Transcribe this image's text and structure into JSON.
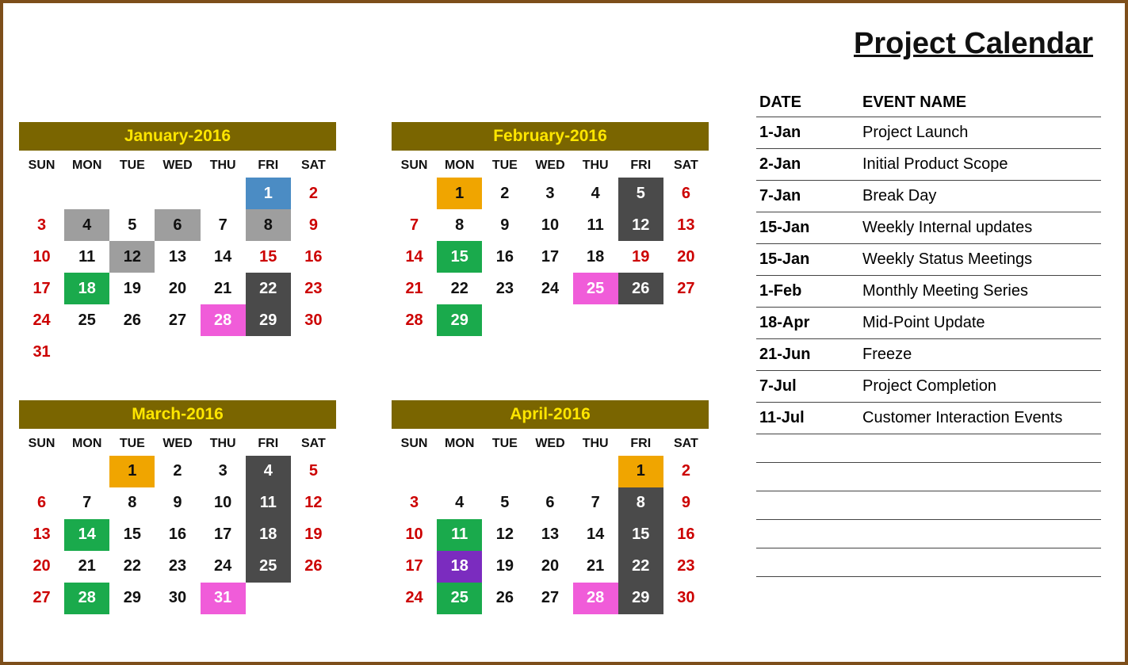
{
  "title": "Project Calendar",
  "dayHeaders": [
    "SUN",
    "MON",
    "TUE",
    "WED",
    "THU",
    "FRI",
    "SAT"
  ],
  "months": [
    {
      "title": "January-2016",
      "offset": 5,
      "days": [
        {
          "n": 1,
          "c": "bg-blue"
        },
        {
          "n": 2,
          "c": "red"
        },
        {
          "n": 3,
          "c": "red"
        },
        {
          "n": 4,
          "c": "bg-gray"
        },
        {
          "n": 5
        },
        {
          "n": 6,
          "c": "bg-gray"
        },
        {
          "n": 7
        },
        {
          "n": 8,
          "c": "bg-gray"
        },
        {
          "n": 9,
          "c": "red"
        },
        {
          "n": 10,
          "c": "red"
        },
        {
          "n": 11
        },
        {
          "n": 12,
          "c": "bg-gray"
        },
        {
          "n": 13
        },
        {
          "n": 14
        },
        {
          "n": 15,
          "c": "red"
        },
        {
          "n": 16,
          "c": "red"
        },
        {
          "n": 17,
          "c": "red"
        },
        {
          "n": 18,
          "c": "bg-green"
        },
        {
          "n": 19
        },
        {
          "n": 20
        },
        {
          "n": 21
        },
        {
          "n": 22,
          "c": "bg-dark"
        },
        {
          "n": 23,
          "c": "red"
        },
        {
          "n": 24,
          "c": "red"
        },
        {
          "n": 25
        },
        {
          "n": 26
        },
        {
          "n": 27
        },
        {
          "n": 28,
          "c": "bg-pink"
        },
        {
          "n": 29,
          "c": "bg-dark"
        },
        {
          "n": 30,
          "c": "red"
        },
        {
          "n": 31,
          "c": "red"
        }
      ]
    },
    {
      "title": "February-2016",
      "offset": 1,
      "days": [
        {
          "n": 1,
          "c": "bg-orange"
        },
        {
          "n": 2
        },
        {
          "n": 3
        },
        {
          "n": 4
        },
        {
          "n": 5,
          "c": "bg-dark"
        },
        {
          "n": 6,
          "c": "red"
        },
        {
          "n": 7,
          "c": "red"
        },
        {
          "n": 8
        },
        {
          "n": 9
        },
        {
          "n": 10
        },
        {
          "n": 11
        },
        {
          "n": 12,
          "c": "bg-dark"
        },
        {
          "n": 13,
          "c": "red"
        },
        {
          "n": 14,
          "c": "red"
        },
        {
          "n": 15,
          "c": "bg-green"
        },
        {
          "n": 16
        },
        {
          "n": 17
        },
        {
          "n": 18
        },
        {
          "n": 19,
          "c": "red"
        },
        {
          "n": 20,
          "c": "red"
        },
        {
          "n": 21,
          "c": "red"
        },
        {
          "n": 22
        },
        {
          "n": 23
        },
        {
          "n": 24
        },
        {
          "n": 25,
          "c": "bg-pink"
        },
        {
          "n": 26,
          "c": "bg-dark"
        },
        {
          "n": 27,
          "c": "red"
        },
        {
          "n": 28,
          "c": "red"
        },
        {
          "n": 29,
          "c": "bg-green"
        }
      ]
    },
    {
      "title": "March-2016",
      "offset": 2,
      "days": [
        {
          "n": 1,
          "c": "bg-orange"
        },
        {
          "n": 2
        },
        {
          "n": 3
        },
        {
          "n": 4,
          "c": "bg-dark"
        },
        {
          "n": 5,
          "c": "red"
        },
        {
          "n": 6,
          "c": "red"
        },
        {
          "n": 7
        },
        {
          "n": 8
        },
        {
          "n": 9
        },
        {
          "n": 10
        },
        {
          "n": 11,
          "c": "bg-dark"
        },
        {
          "n": 12,
          "c": "red"
        },
        {
          "n": 13,
          "c": "red"
        },
        {
          "n": 14,
          "c": "bg-green"
        },
        {
          "n": 15
        },
        {
          "n": 16
        },
        {
          "n": 17
        },
        {
          "n": 18,
          "c": "bg-dark"
        },
        {
          "n": 19,
          "c": "red"
        },
        {
          "n": 20,
          "c": "red"
        },
        {
          "n": 21
        },
        {
          "n": 22
        },
        {
          "n": 23
        },
        {
          "n": 24
        },
        {
          "n": 25,
          "c": "bg-dark"
        },
        {
          "n": 26,
          "c": "red"
        },
        {
          "n": 27,
          "c": "red"
        },
        {
          "n": 28,
          "c": "bg-green"
        },
        {
          "n": 29
        },
        {
          "n": 30
        },
        {
          "n": 31,
          "c": "bg-pink"
        }
      ]
    },
    {
      "title": "April-2016",
      "offset": 5,
      "days": [
        {
          "n": 1,
          "c": "bg-orange"
        },
        {
          "n": 2,
          "c": "red"
        },
        {
          "n": 3,
          "c": "red"
        },
        {
          "n": 4
        },
        {
          "n": 5
        },
        {
          "n": 6
        },
        {
          "n": 7
        },
        {
          "n": 8,
          "c": "bg-dark"
        },
        {
          "n": 9,
          "c": "red"
        },
        {
          "n": 10,
          "c": "red"
        },
        {
          "n": 11,
          "c": "bg-green"
        },
        {
          "n": 12
        },
        {
          "n": 13
        },
        {
          "n": 14
        },
        {
          "n": 15,
          "c": "bg-dark"
        },
        {
          "n": 16,
          "c": "red"
        },
        {
          "n": 17,
          "c": "red"
        },
        {
          "n": 18,
          "c": "bg-purple"
        },
        {
          "n": 19
        },
        {
          "n": 20
        },
        {
          "n": 21
        },
        {
          "n": 22,
          "c": "bg-dark"
        },
        {
          "n": 23,
          "c": "red"
        },
        {
          "n": 24,
          "c": "red"
        },
        {
          "n": 25,
          "c": "bg-green"
        },
        {
          "n": 26
        },
        {
          "n": 27
        },
        {
          "n": 28,
          "c": "bg-pink"
        },
        {
          "n": 29,
          "c": "bg-dark"
        },
        {
          "n": 30,
          "c": "red"
        }
      ]
    }
  ],
  "eventsHeader": {
    "date": "DATE",
    "name": "EVENT NAME"
  },
  "events": [
    {
      "date": "1-Jan",
      "name": "Project Launch"
    },
    {
      "date": "2-Jan",
      "name": "Initial Product Scope"
    },
    {
      "date": "7-Jan",
      "name": "Break Day"
    },
    {
      "date": "15-Jan",
      "name": "Weekly Internal updates"
    },
    {
      "date": "15-Jan",
      "name": "Weekly Status Meetings"
    },
    {
      "date": "1-Feb",
      "name": "Monthly Meeting Series"
    },
    {
      "date": "18-Apr",
      "name": "Mid-Point Update"
    },
    {
      "date": "21-Jun",
      "name": "Freeze"
    },
    {
      "date": "7-Jul",
      "name": "Project Completion"
    },
    {
      "date": "11-Jul",
      "name": "Customer Interaction Events"
    }
  ],
  "emptyRows": 5
}
